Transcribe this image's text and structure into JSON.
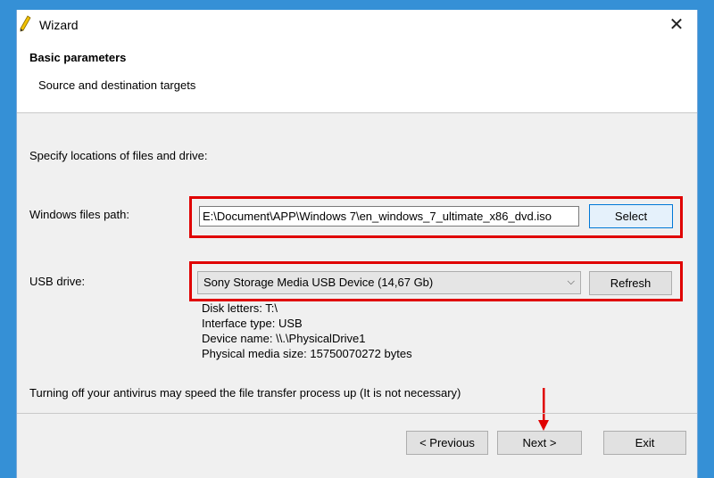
{
  "window": {
    "title": "Wizard",
    "close_glyph": "✕"
  },
  "header": {
    "title": "Basic parameters",
    "subtitle": "Source and destination targets"
  },
  "body": {
    "intro": "Specify locations of files and drive:",
    "windows_path_label": "Windows files path:",
    "windows_path_value": "E:\\Document\\APP\\Windows 7\\en_windows_7_ultimate_x86_dvd.iso",
    "select_button": "Select",
    "usb_label": "USB drive:",
    "usb_selected": "Sony Storage Media USB Device (14,67 Gb)",
    "refresh_button": "Refresh",
    "info": [
      "Disk letters: T:\\",
      "Interface type: USB",
      "Device name: \\\\.\\PhysicalDrive1",
      "Physical media size: 15750070272 bytes"
    ],
    "note": "Turning off your antivirus may speed the file transfer process up (It is not necessary)"
  },
  "footer": {
    "previous": "< Previous",
    "next": "Next >",
    "exit": "Exit"
  },
  "colors": {
    "annotation": "#e00000",
    "desktop": "#3590d6"
  },
  "icons": {
    "app": "pencil-icon",
    "close": "close-icon",
    "dropdown": "chevron-down-icon",
    "annotation": "down-arrow-icon"
  }
}
